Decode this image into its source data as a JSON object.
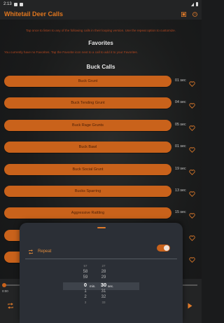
{
  "status_bar": {
    "time": "2:13"
  },
  "app_bar": {
    "title": "Whitetail Deer Calls",
    "icons": [
      "grid-icon",
      "help-icon"
    ]
  },
  "intro_text": "Tap once to listen to any of the following calls in their looping version. Use the repeat option to customize.",
  "favorites": {
    "title": "Favorites",
    "note": "You currently have no Favorites. Tap the Favorite icon next to a call to add it to your Favorites."
  },
  "buck_calls": {
    "title": "Buck Calls",
    "items": [
      {
        "name": "Buck Grunt",
        "duration": "01 sec"
      },
      {
        "name": "Buck Tending Grunt",
        "duration": "04 sec"
      },
      {
        "name": "Buck Rage Grunts",
        "duration": "05 sec"
      },
      {
        "name": "Buck Bawl",
        "duration": "01 sec"
      },
      {
        "name": "Buck Social Grunt",
        "duration": "19 sec"
      },
      {
        "name": "Bucks Sparring",
        "duration": "13 sec"
      },
      {
        "name": "Aggressive Rattling",
        "duration": "15 sec"
      },
      {
        "name": "",
        "duration": ""
      },
      {
        "name": "",
        "duration": ""
      }
    ]
  },
  "player": {
    "elapsed": "0:00"
  },
  "repeat_sheet": {
    "repeat_label": "Repeat",
    "repeat_enabled": true,
    "accent": "#c9621b",
    "minutes_column": [
      "57",
      "58",
      "59",
      "0",
      "1",
      "2",
      "3"
    ],
    "seconds_column": [
      "27",
      "28",
      "29",
      "30",
      "31",
      "32",
      "33"
    ],
    "minutes_unit": "min.",
    "seconds_unit": "sec."
  }
}
